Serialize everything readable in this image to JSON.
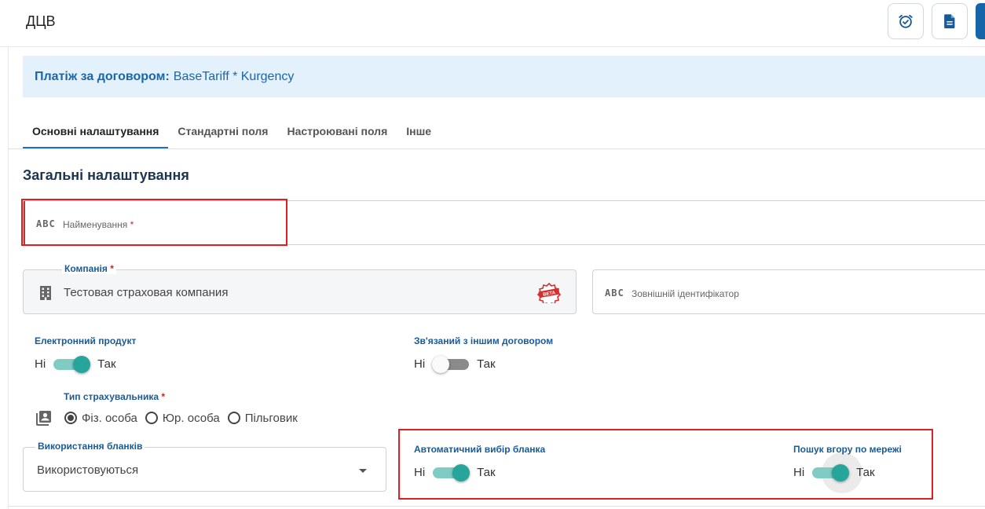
{
  "app": {
    "title": "ДЦВ"
  },
  "toolbar": {
    "alarm_icon": "alarm-check-icon",
    "document_icon": "document-icon"
  },
  "banner": {
    "label": "Платіж за договором:",
    "value": "BaseTariff * Kurgency"
  },
  "tabs": [
    {
      "label": "Основні налаштування",
      "active": true
    },
    {
      "label": "Стандартні поля"
    },
    {
      "label": "Настроювані поля"
    },
    {
      "label": "Інше"
    }
  ],
  "section": {
    "title": "Загальні налаштування"
  },
  "fields": {
    "name": {
      "icon_text": "ABC",
      "placeholder": "Найменування",
      "required": "*"
    },
    "company": {
      "label": "Компанія",
      "required": "*",
      "value": "Тестовая страховая компания",
      "badge": "BETA"
    },
    "external_id": {
      "icon_text": "ABC",
      "placeholder": "Зовнішній ідентифікатор"
    }
  },
  "toggles": {
    "electronic_product": {
      "label": "Електронний продукт",
      "off_text": "Ні",
      "on_text": "Так",
      "on": true
    },
    "linked_contract": {
      "label": "Зв'язаний з іншим договором",
      "off_text": "Ні",
      "on_text": "Так",
      "on": false
    },
    "auto_blank": {
      "label": "Автоматичний вибір бланка",
      "off_text": "Ні",
      "on_text": "Так",
      "on": true
    },
    "network_search": {
      "label": "Пошук вгору по мережі",
      "off_text": "Ні",
      "on_text": "Так",
      "on": true
    }
  },
  "insurer_type": {
    "label": "Тип страхувальника",
    "required": "*",
    "options": [
      "Фіз. особа",
      "Юр. особа",
      "Пільговик"
    ],
    "selected": "Фіз. особа"
  },
  "blanks": {
    "label": "Використання бланків",
    "value": "Використовуються"
  },
  "colors": {
    "accent": "#1a73b8",
    "toggle_on": "#26a69a",
    "highlight": "#e02020",
    "banner_bg": "#e3f1fc"
  }
}
